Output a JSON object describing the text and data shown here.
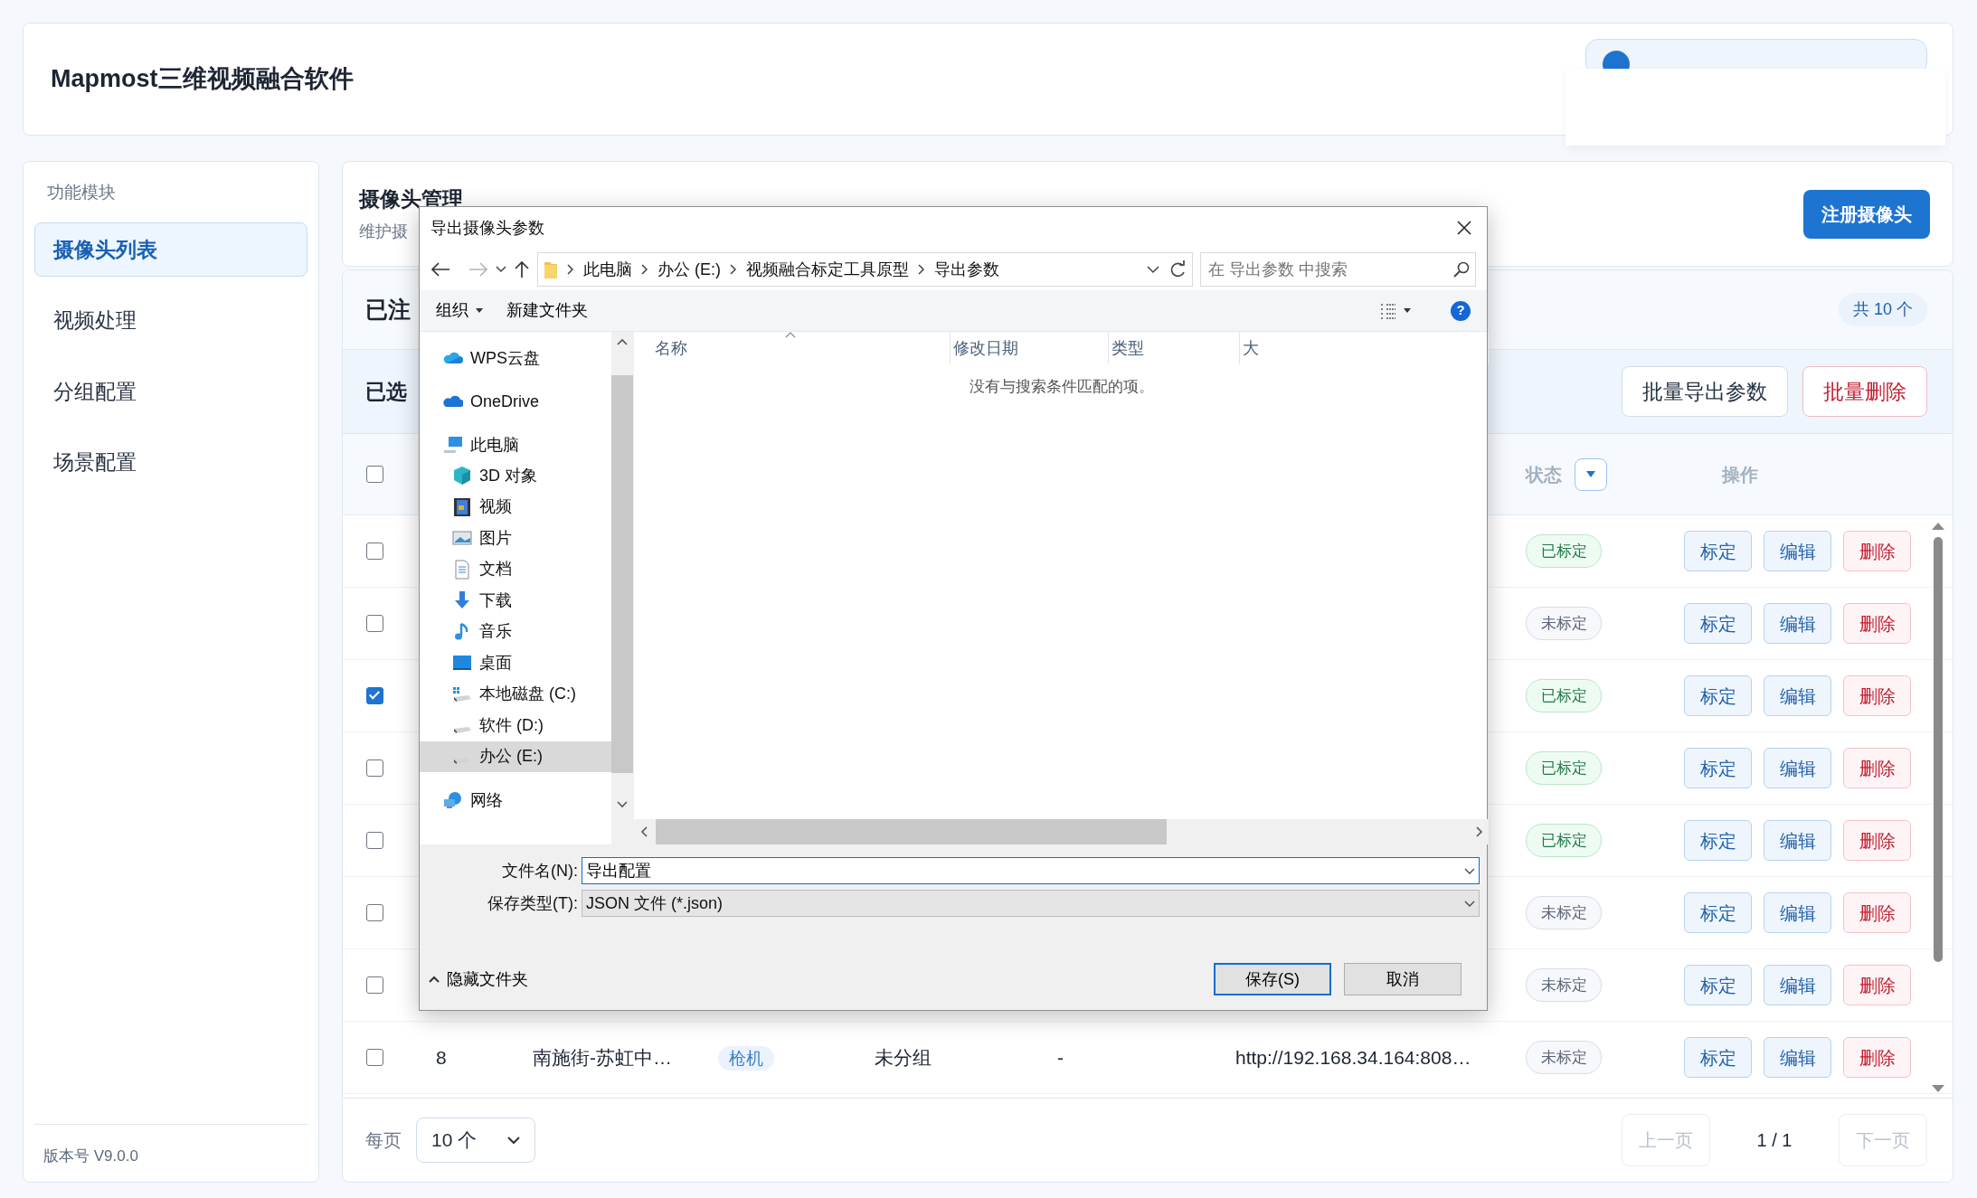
{
  "app": {
    "title": "Mapmost三维视频融合软件"
  },
  "sidebar": {
    "heading": "功能模块",
    "items": [
      {
        "label": "摄像头列表",
        "selected": true
      },
      {
        "label": "视频处理",
        "selected": false
      },
      {
        "label": "分组配置",
        "selected": false
      },
      {
        "label": "场景配置",
        "selected": false
      }
    ],
    "version": "版本号 V9.0.0"
  },
  "page": {
    "title": "摄像头管理",
    "subtitle": "维护摄",
    "register_button": "注册摄像头"
  },
  "list": {
    "title": "已注",
    "count": "共 10 个",
    "selection_label": "已选",
    "export_button": "批量导出参数",
    "delete_button": "批量删除",
    "header_checked": false,
    "status_column": "状态",
    "actions_column": "操作",
    "rows": [
      {
        "checked": false,
        "status": "已标定",
        "kind": "calibrated",
        "actions": [
          {
            "label": "标定",
            "kind": "primary"
          },
          {
            "label": "编辑",
            "kind": "primary"
          },
          {
            "label": "删除",
            "kind": "danger"
          }
        ]
      },
      {
        "checked": false,
        "status": "未标定",
        "kind": "uncalibrated",
        "actions": [
          {
            "label": "标定",
            "kind": "primary"
          },
          {
            "label": "编辑",
            "kind": "primary"
          },
          {
            "label": "删除",
            "kind": "danger"
          }
        ]
      },
      {
        "checked": true,
        "status": "已标定",
        "kind": "calibrated",
        "actions": [
          {
            "label": "标定",
            "kind": "primary"
          },
          {
            "label": "编辑",
            "kind": "primary"
          },
          {
            "label": "删除",
            "kind": "danger"
          }
        ]
      },
      {
        "checked": false,
        "status": "已标定",
        "kind": "calibrated",
        "actions": [
          {
            "label": "标定",
            "kind": "primary"
          },
          {
            "label": "编辑",
            "kind": "primary"
          },
          {
            "label": "删除",
            "kind": "danger"
          }
        ]
      },
      {
        "checked": false,
        "status": "已标定",
        "kind": "calibrated",
        "actions": [
          {
            "label": "标定",
            "kind": "primary"
          },
          {
            "label": "编辑",
            "kind": "primary"
          },
          {
            "label": "删除",
            "kind": "danger"
          }
        ]
      },
      {
        "checked": false,
        "status": "未标定",
        "kind": "uncalibrated",
        "actions": [
          {
            "label": "标定",
            "kind": "primary"
          },
          {
            "label": "编辑",
            "kind": "primary"
          },
          {
            "label": "删除",
            "kind": "danger"
          }
        ]
      },
      {
        "checked": false,
        "status": "未标定",
        "kind": "uncalibrated",
        "actions": [
          {
            "label": "标定",
            "kind": "primary"
          },
          {
            "label": "编辑",
            "kind": "primary"
          },
          {
            "label": "删除",
            "kind": "danger"
          }
        ]
      },
      {
        "checked": false,
        "no": "8",
        "name": "南施街-苏虹中…",
        "type": "枪机",
        "group": "未分组",
        "column_6": "-",
        "url": "http://192.168.34.164:808…",
        "status": "未标定",
        "kind": "uncalibrated",
        "actions": [
          {
            "label": "标定",
            "kind": "primary"
          },
          {
            "label": "编辑",
            "kind": "primary"
          },
          {
            "label": "删除",
            "kind": "danger"
          }
        ]
      }
    ],
    "per_page_label": "每页",
    "per_page": "10 个",
    "prev": {
      "label": "上一页",
      "disabled": true
    },
    "page": "1 / 1",
    "next": {
      "label": "下一页",
      "disabled": true
    }
  },
  "dialog": {
    "title": "导出摄像头参数",
    "path": [
      "此电脑",
      "办公 (E:)",
      "视频融合标定工具原型",
      "导出参数"
    ],
    "search_placeholder": "在 导出参数 中搜索",
    "organize": "组织",
    "new_folder": "新建文件夹",
    "help": "?",
    "tree": [
      {
        "label": "WPS云盘",
        "selected": false
      },
      {
        "label": "OneDrive",
        "selected": false
      },
      {
        "label": "此电脑",
        "selected": false,
        "children": [
          {
            "label": "3D 对象",
            "selected": false
          },
          {
            "label": "视频",
            "selected": false
          },
          {
            "label": "图片",
            "selected": false
          },
          {
            "label": "文档",
            "selected": false
          },
          {
            "label": "下载",
            "selected": false
          },
          {
            "label": "音乐",
            "selected": false
          },
          {
            "label": "桌面",
            "selected": false
          },
          {
            "label": "本地磁盘 (C:)",
            "selected": false
          },
          {
            "label": "软件 (D:)",
            "selected": false
          },
          {
            "label": "办公 (E:)",
            "selected": true
          }
        ]
      },
      {
        "label": "网络",
        "selected": false
      }
    ],
    "columns": [
      "名称",
      "修改日期",
      "类型",
      "大"
    ],
    "empty_message": "没有与搜索条件匹配的项。",
    "file_name_label": "文件名(N):",
    "file_name": "导出配置",
    "file_type_label": "保存类型(T):",
    "file_type": "JSON 文件 (*.json)",
    "hide_folders": "隐藏文件夹",
    "save": "保存(S)",
    "cancel": "取消"
  }
}
